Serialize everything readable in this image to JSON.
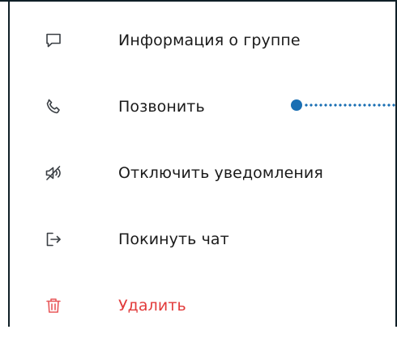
{
  "menu": {
    "items": [
      {
        "label": "Информация о группе",
        "icon": "chat-bubble-icon"
      },
      {
        "label": "Позвонить",
        "icon": "phone-icon"
      },
      {
        "label": "Отключить уведомления",
        "icon": "muted-speaker-icon"
      },
      {
        "label": "Покинуть чат",
        "icon": "leave-icon"
      },
      {
        "label": "Удалить",
        "icon": "trash-icon"
      }
    ]
  },
  "colors": {
    "text": "#1a1a1a",
    "danger": "#e23b3b",
    "icon": "#3a3f44",
    "callout": "#1a6fb3",
    "border": "#0f1f27"
  }
}
